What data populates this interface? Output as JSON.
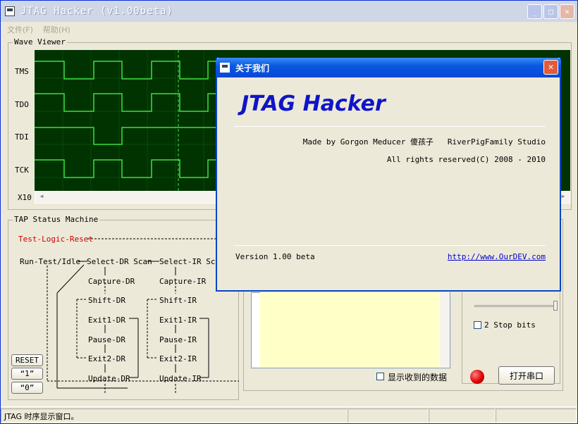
{
  "window": {
    "title": "JTAG Hacker (v1.00beta)",
    "min": "_",
    "max": "□",
    "close": "✕"
  },
  "menu": [
    {
      "label": "文件(F)"
    },
    {
      "label": "帮助(H)"
    }
  ],
  "wave_viewer": {
    "label": "Wave Viewer",
    "tracks": [
      {
        "name": "TMS"
      },
      {
        "name": "TDO"
      },
      {
        "name": "TDI"
      },
      {
        "name": "TCK"
      }
    ],
    "zoom": "X10"
  },
  "tap": {
    "label": "TAP Status Machine",
    "reset_state": "Test-Logic-Reset",
    "idle": "Run-Test/Idle",
    "dr": [
      "Select-DR Scan",
      "Capture-DR",
      "Shift-DR",
      "Exit1-DR",
      "Pause-DR",
      "Exit2-DR",
      "Update-DR"
    ],
    "ir": [
      "Select-IR Scan",
      "Capture-IR",
      "Shift-IR",
      "Exit1-IR",
      "Pause-IR",
      "Exit2-IR",
      "Update-IR"
    ],
    "buttons": {
      "reset": "RESET",
      "one": "“1”",
      "zero": "“0”"
    }
  },
  "serial": {
    "stop_bits": "2 Stop bits",
    "show_received": "显示收到的数据",
    "open_port": "打开串口",
    "led_color": "#e00000"
  },
  "status": {
    "text": "JTAG 时序显示窗口。"
  },
  "about": {
    "title": "关于我们",
    "product": "JTAG Hacker",
    "made_by": "Made by Gorgon Meducer 傻孩子   RiverPigFamily Studio",
    "rights": "All rights reserved(C) 2008 - 2010",
    "version": "Version 1.00 beta",
    "url": "http://www.OurDEV.com"
  }
}
